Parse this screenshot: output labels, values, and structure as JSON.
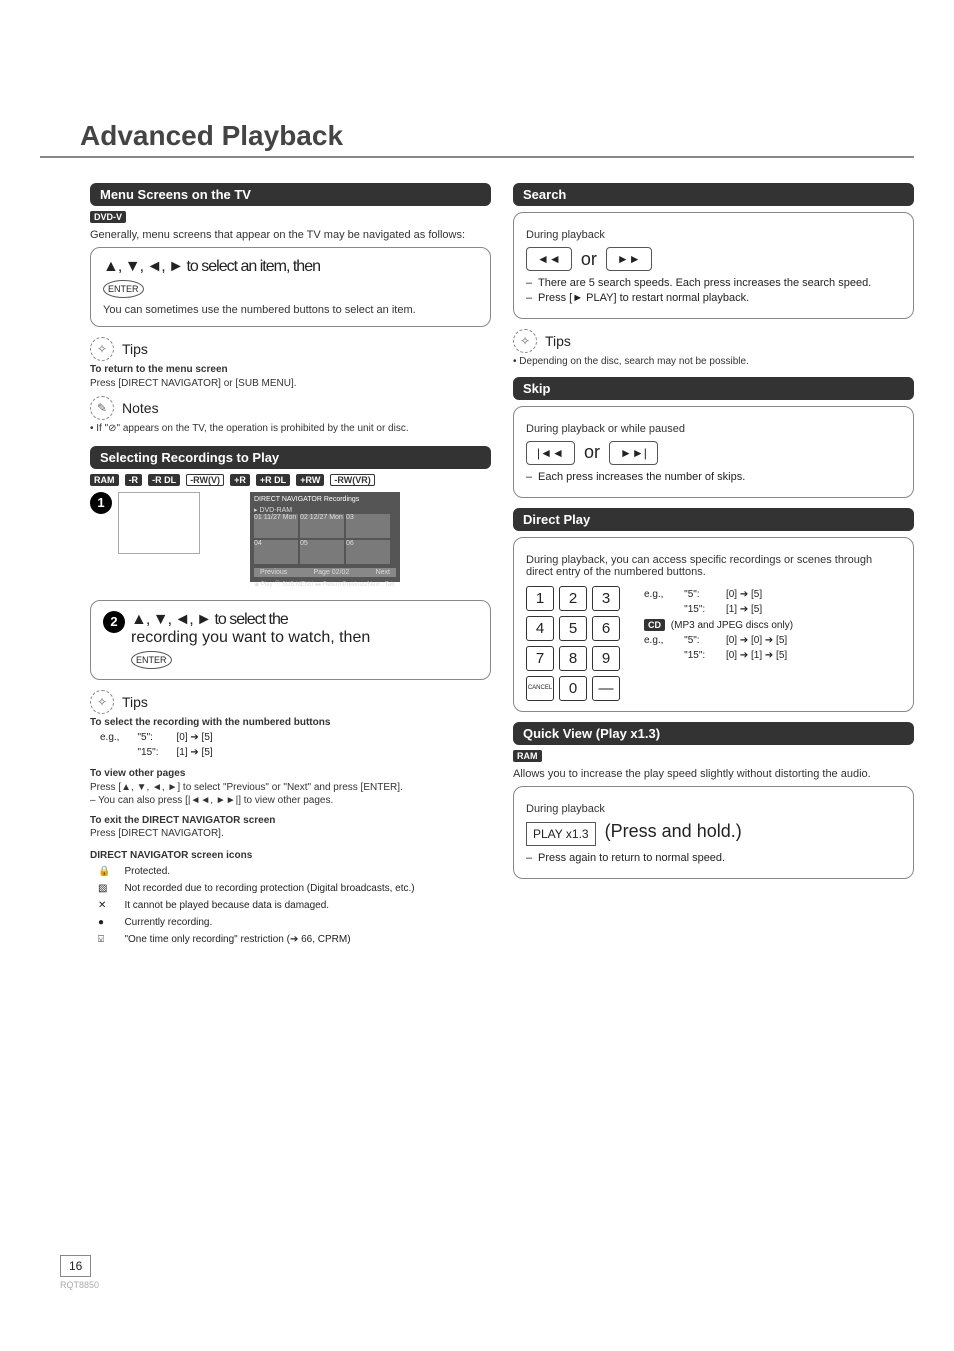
{
  "title": "Advanced Playback",
  "page_number": "16",
  "page_code": "RQT8850",
  "left": {
    "menu_bar": "Menu Screens on the TV",
    "dvdv": "DVD-V",
    "intro": "Generally, menu screens that appear on the TV may be navigated as follows:",
    "step1_line": "▲, ▼, ◄, ► to select an item, then",
    "enter": "ENTER",
    "step1_sub": "You can sometimes use the numbered buttons to select an item.",
    "tips_label": "Tips",
    "tips1_h": "To return to the menu screen",
    "tips1_b": "Press [DIRECT NAVIGATOR] or [SUB MENU].",
    "notes_label": "Notes",
    "note1": "• If \"⊘\" appears on the TV, the operation is prohibited by the unit or disc.",
    "select_bar": "Selecting Recordings to Play",
    "tags": [
      "RAM",
      "-R",
      "-R DL",
      "-RW(V)",
      "+R",
      "+R DL",
      "+RW",
      "-RW(VR)"
    ],
    "screen_title": "DIRECT NAVIGATOR   Recordings",
    "screen_sub": "▸ DVD-RAM",
    "screen_cells": [
      "01  11/27 Mon",
      "02  12/27 Mon",
      "03",
      "04",
      "05",
      "06"
    ],
    "screen_foot_prev": "Previous",
    "screen_foot_page": "Page   02/02",
    "screen_foot_next": "Next",
    "screen_hint": "◉ Play  ⓘ SUB MENU  ▸▸ Return   Previous/Next : Tab",
    "step2_line1": "▲, ▼, ◄, ► to select the",
    "step2_line2": "recording you want to watch, then",
    "tips2_h1": "To select the recording with the numbered buttons",
    "eg_label": "e.g.,",
    "eg_5": "\"5\":",
    "eg_5v": "[0] ➔ [5]",
    "eg_15": "\"15\":",
    "eg_15v": "[1] ➔ [5]",
    "tips2_h2": "To view other pages",
    "tips2_b2a": "Press [▲, ▼, ◄, ►] to select \"Previous\" or \"Next\" and press [ENTER].",
    "tips2_b2b": "– You can also press [|◄◄, ►►|] to view other pages.",
    "tips2_h3": "To exit the DIRECT NAVIGATOR screen",
    "tips2_b3": "Press [DIRECT NAVIGATOR].",
    "icons_h": "DIRECT NAVIGATOR screen icons",
    "icons": [
      [
        "🔒",
        "Protected."
      ],
      [
        "▨",
        "Not recorded due to recording protection (Digital broadcasts, etc.)"
      ],
      [
        "✕",
        "It cannot be played because data is damaged."
      ],
      [
        "●",
        "Currently recording."
      ],
      [
        "⍌",
        "\"One time only recording\" restriction (➔ 66, CPRM)"
      ]
    ]
  },
  "right": {
    "search_bar": "Search",
    "search_during": "During playback",
    "search_or": "or",
    "search_l1": "There are 5 search speeds. Each press increases the search speed.",
    "search_l2": "Press [► PLAY] to restart normal playback.",
    "tips_label": "Tips",
    "search_tip": "• Depending on the disc, search may not be possible.",
    "skip_bar": "Skip",
    "skip_during": "During playback or while paused",
    "skip_or": "or",
    "skip_l1": "Each press increases the number of skips.",
    "direct_bar": "Direct Play",
    "direct_intro": "During playback, you can access specific recordings or scenes through direct entry of the numbered buttons.",
    "keys": [
      "1",
      "2",
      "3",
      "4",
      "5",
      "6",
      "7",
      "8",
      "9"
    ],
    "key_cancel": "CANCEL",
    "key_zero": "0",
    "eg_label": "e.g.,",
    "d5": "\"5\":",
    "d5v": "[0] ➔ [5]",
    "d15": "\"15\":",
    "d15v": "[1] ➔ [5]",
    "cd_label": "CD",
    "cd_note": "(MP3 and JPEG discs only)",
    "c5": "\"5\":",
    "c5v": "[0] ➔ [0] ➔ [5]",
    "c15": "\"15\":",
    "c15v": "[0] ➔ [1] ➔ [5]",
    "qv_bar": "Quick View (Play x1.3)",
    "ram": "RAM",
    "qv_intro": "Allows you to increase the play speed slightly without distorting the audio.",
    "qv_during": "During playback",
    "qv_button": "PLAY x1.3",
    "qv_press": "(Press and hold.)",
    "qv_l1": "Press again to return to normal speed."
  }
}
